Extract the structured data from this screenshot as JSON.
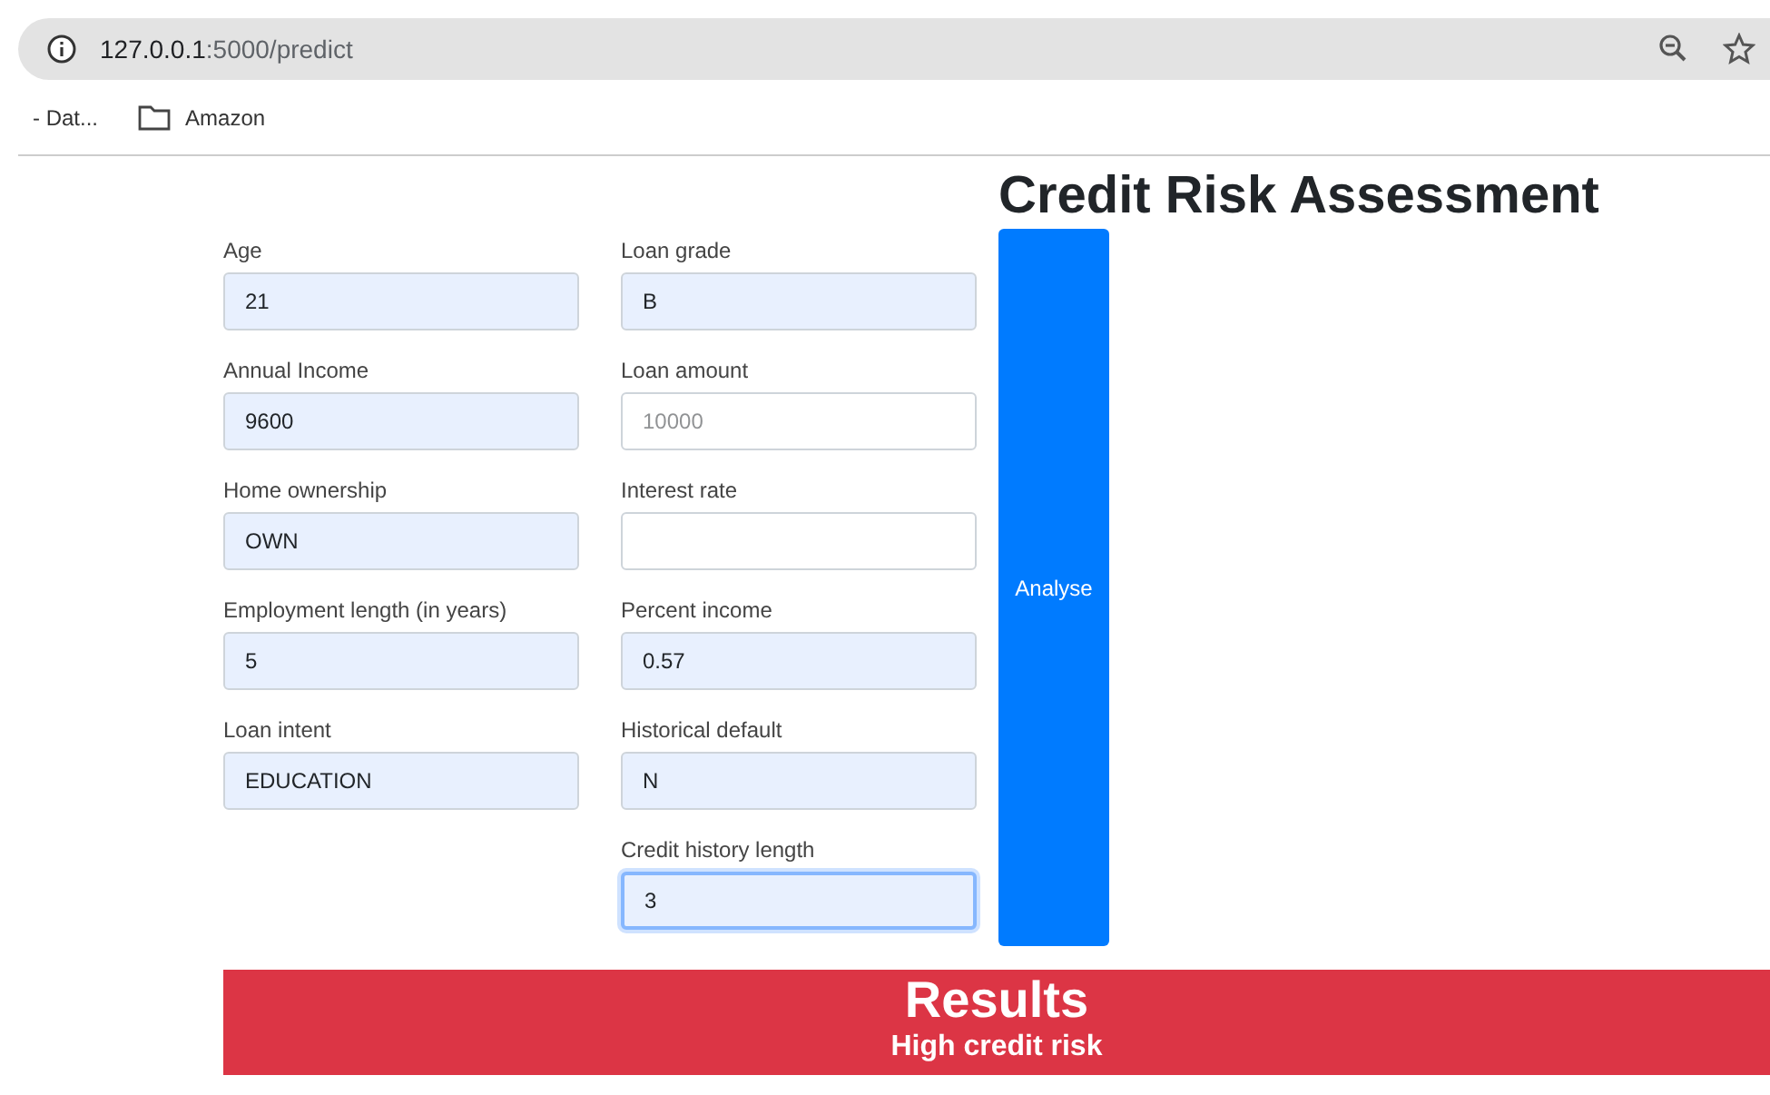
{
  "browser": {
    "url_host": "127.0.0.1",
    "url_rest": ":5000/predict",
    "bookmarks": [
      {
        "label": "- Dat...",
        "kind": "text"
      },
      {
        "label": "Amazon",
        "kind": "folder"
      }
    ]
  },
  "page": {
    "title": "Credit Risk Assessment",
    "columns": [
      [
        {
          "label": "Age",
          "value": "21",
          "autofilled": true,
          "focused": false
        },
        {
          "label": "Annual Income",
          "value": "9600",
          "autofilled": true,
          "focused": false
        },
        {
          "label": "Home ownership",
          "value": "OWN",
          "autofilled": true,
          "focused": false
        },
        {
          "label": "Employment length (in years)",
          "value": "5",
          "autofilled": true,
          "focused": false
        },
        {
          "label": "Loan intent",
          "value": "EDUCATION",
          "autofilled": true,
          "focused": false
        }
      ],
      [
        {
          "label": "Loan grade",
          "value": "B",
          "autofilled": true,
          "focused": false
        },
        {
          "label": "Loan amount",
          "placeholder": "10000",
          "autofilled": false,
          "focused": false
        },
        {
          "label": "Interest rate",
          "autofilled": false,
          "focused": false
        },
        {
          "label": "Percent income",
          "value": "0.57",
          "autofilled": true,
          "focused": false
        },
        {
          "label": "Historical default",
          "value": "N",
          "autofilled": true,
          "focused": false
        },
        {
          "label": "Credit history length",
          "value": "3",
          "autofilled": true,
          "focused": true
        }
      ]
    ],
    "submit": "Analyse",
    "results": {
      "title": "Results",
      "message": "High credit risk"
    }
  }
}
